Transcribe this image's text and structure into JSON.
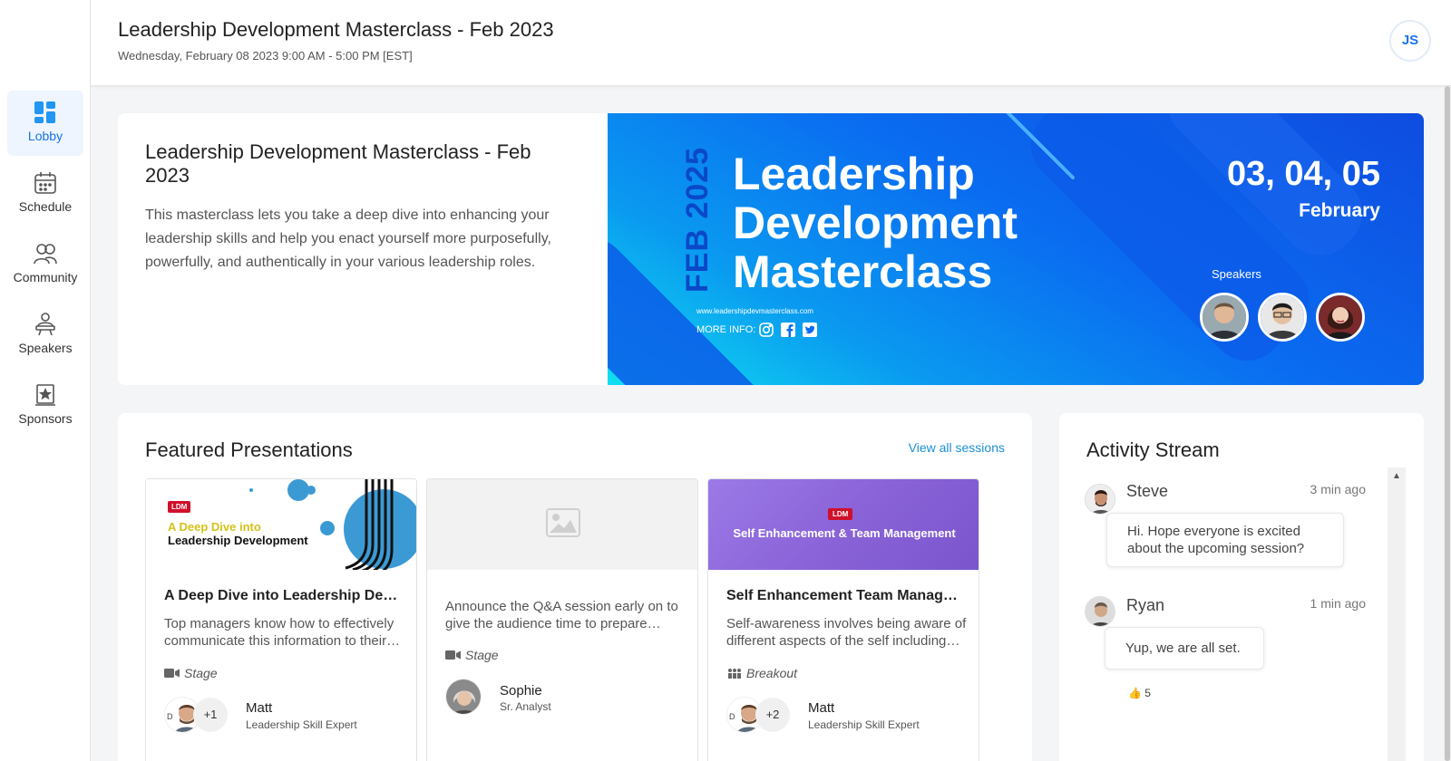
{
  "sidebar": {
    "items": [
      {
        "label": "Lobby",
        "icon": "dashboard-icon",
        "active": true
      },
      {
        "label": "Schedule",
        "icon": "calendar-icon",
        "active": false
      },
      {
        "label": "Community",
        "icon": "people-icon",
        "active": false
      },
      {
        "label": "Speakers",
        "icon": "podium-icon",
        "active": false
      },
      {
        "label": "Sponsors",
        "icon": "star-badge-icon",
        "active": false
      }
    ]
  },
  "header": {
    "title": "Leadership Development Masterclass - Feb 2023",
    "subtitle": "Wednesday, February 08 2023 9:00 AM - 5:00 PM [EST]",
    "user_initials": "JS"
  },
  "hero": {
    "title": "Leadership Development Masterclass - Feb 2023",
    "description": "This masterclass lets you take a deep dive into enhancing your leadership skills and help you enact yourself more purposefully, powerfully, and authentically in your various leadership roles.",
    "banner": {
      "vertical_text": "FEB 2025",
      "title_lines": [
        "Leadership",
        "Development",
        "Masterclass"
      ],
      "dates": "03, 04, 05",
      "month": "February",
      "speakers_label": "Speakers",
      "url": "www.leadershipdevmasterclass.com",
      "more_info": "MORE INFO:"
    }
  },
  "featured": {
    "title": "Featured Presentations",
    "view_all": "View all sessions",
    "cards": [
      {
        "thumb_badge": "LDM",
        "thumb_line1": "A Deep Dive into",
        "thumb_line2": "Leadership Development",
        "title": "A Deep Dive into Leadership Development",
        "description": "Top managers know how to effectively communicate this information to their teams.",
        "type": "Stage",
        "speaker_initial": "D",
        "extra_count": "+1",
        "speaker_name": "Matt",
        "speaker_role": "Leadership Skill Expert"
      },
      {
        "title": "",
        "description": "Announce the Q&A session early on to give the audience time to prepare questions.",
        "type": "Stage",
        "speaker_name": "Sophie",
        "speaker_role": "Sr. Analyst"
      },
      {
        "thumb_badge": "LDM",
        "thumb_line1": "Self Enhancement & Team Management",
        "title": "Self Enhancement Team Management",
        "description": "Self-awareness involves being aware of different aspects of the self including traits.",
        "type": "Breakout",
        "speaker_initial": "D",
        "extra_count": "+2",
        "speaker_name": "Matt",
        "speaker_role": "Leadership Skill Expert"
      }
    ]
  },
  "activity": {
    "title": "Activity Stream",
    "posts": [
      {
        "name": "Steve",
        "time": "3 min ago",
        "message": "Hi. Hope everyone is excited about the upcoming session?"
      },
      {
        "name": "Ryan",
        "time": "1 min ago",
        "message": "Yup, we are all set.",
        "reaction_emoji": "👍",
        "reaction_count": "5"
      }
    ]
  },
  "colors": {
    "accent": "#1a73e8",
    "banner_blue": "#0a6cf0",
    "banner_cyan": "#11e0f0",
    "link": "#1a8fd8",
    "ldm_red": "#d0102a",
    "purple": "#8a63d8"
  }
}
